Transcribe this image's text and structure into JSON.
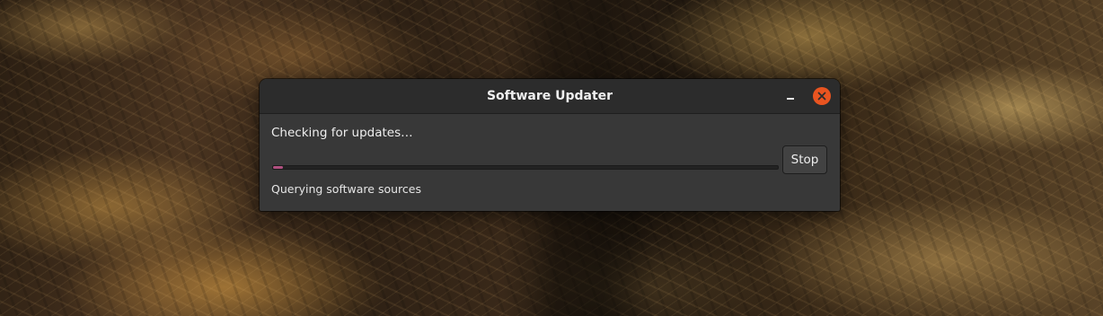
{
  "window": {
    "title": "Software Updater"
  },
  "updater": {
    "heading": "Checking for updates…",
    "stop_label": "Stop",
    "substatus": "Querying software sources",
    "progress_fraction": 0.02
  },
  "icons": {
    "minimize": "minimize-icon",
    "close": "close-icon"
  },
  "colors": {
    "close_button": "#e95420",
    "progress_fill": "#b05080",
    "window_bg": "#383838",
    "titlebar_bg": "#2c2c2c"
  }
}
